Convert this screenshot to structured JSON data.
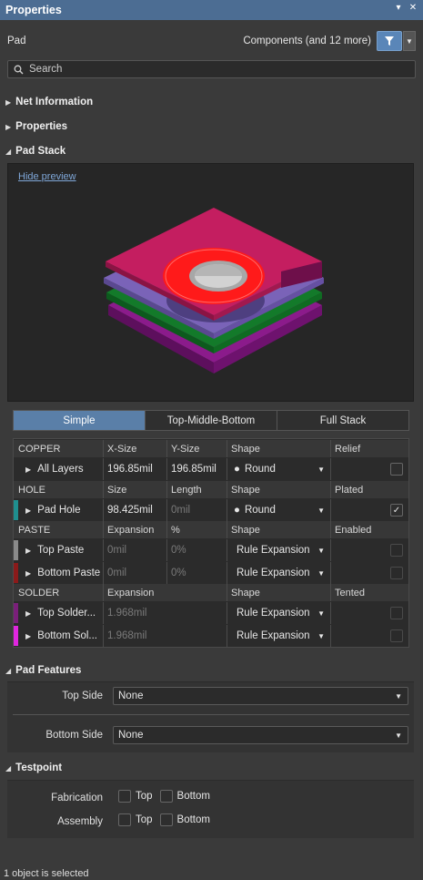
{
  "panel": {
    "title": "Properties",
    "pin_icon": "▾",
    "close_icon": "✕"
  },
  "pad_line": {
    "object": "Pad",
    "filter_text": "Components (and 12 more)"
  },
  "search": {
    "placeholder": "Search"
  },
  "sections": {
    "net_info": "Net Information",
    "properties": "Properties",
    "pad_stack": "Pad Stack",
    "pad_features": "Pad Features",
    "testpoint": "Testpoint"
  },
  "preview": {
    "hide_link": "Hide preview"
  },
  "tabs": {
    "simple": "Simple",
    "tmb": "Top-Middle-Bottom",
    "full": "Full Stack"
  },
  "copper": {
    "header": {
      "name": "COPPER",
      "c1": "X-Size",
      "c2": "Y-Size",
      "c3": "Shape",
      "c4": "Relief"
    },
    "row": {
      "name": "All Layers",
      "xsize": "196.85mil",
      "ysize": "196.85mil",
      "shape": "Round"
    }
  },
  "hole": {
    "header": {
      "name": "HOLE",
      "c1": "Size",
      "c2": "Length",
      "c3": "Shape",
      "c4": "Plated"
    },
    "row": {
      "name": "Pad Hole",
      "size": "98.425mil",
      "length": "0mil",
      "shape": "Round",
      "check": "✓"
    }
  },
  "paste": {
    "header": {
      "name": "PASTE",
      "c1": "Expansion",
      "c2": "%",
      "c3": "Shape",
      "c4": "Enabled"
    },
    "rows": [
      {
        "name": "Top Paste",
        "expansion": "0mil",
        "pct": "0%",
        "shape": "Rule Expansion"
      },
      {
        "name": "Bottom Paste",
        "expansion": "0mil",
        "pct": "0%",
        "shape": "Rule Expansion"
      }
    ]
  },
  "solder": {
    "header": {
      "name": "SOLDER",
      "c1": "Expansion",
      "c3": "Shape",
      "c4": "Tented"
    },
    "rows": [
      {
        "name": "Top Solder...",
        "expansion": "1.968mil",
        "shape": "Rule Expansion"
      },
      {
        "name": "Bottom Sol...",
        "expansion": "1.968mil",
        "shape": "Rule Expansion"
      }
    ]
  },
  "pad_features": {
    "top_label": "Top Side",
    "top_value": "None",
    "bottom_label": "Bottom Side",
    "bottom_value": "None"
  },
  "testpoint": {
    "fab_label": "Fabrication",
    "asm_label": "Assembly",
    "top": "Top",
    "bottom": "Bottom"
  },
  "status": "1 object is selected",
  "colors": {
    "accent": "#4c6d93",
    "hole_layer": "#1f8f8f",
    "top_paste": "#8a8a8a",
    "bottom_paste": "#8b1a1a",
    "top_solder": "#7a1f7a",
    "bottom_solder": "#e026e0"
  }
}
